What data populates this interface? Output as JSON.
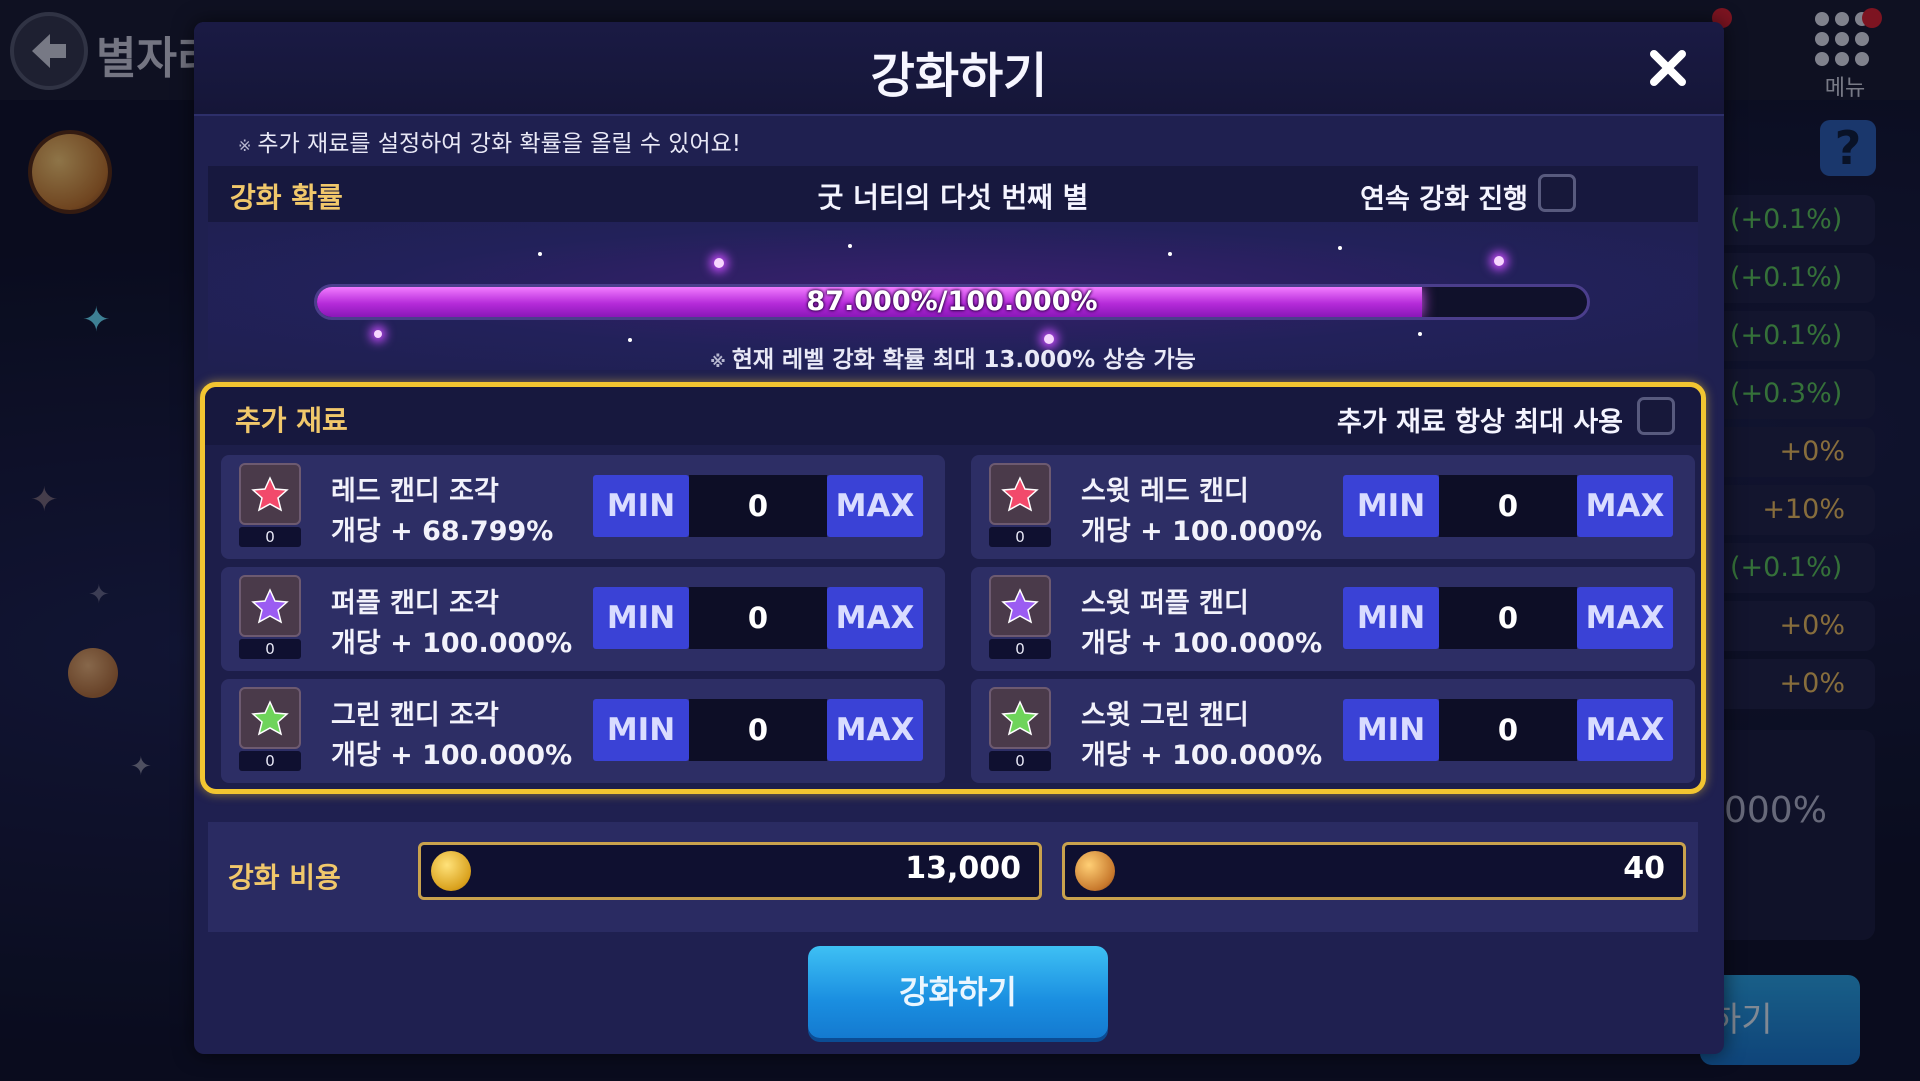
{
  "background": {
    "title": "별자리",
    "menu_label": "메뉴",
    "help_icon_text": "?",
    "side_rows": [
      "(+0.1%)",
      "(+0.1%)",
      "(+0.1%)",
      "(+0.3%)",
      "+0%",
      "+10%",
      "(+0.1%)",
      "+0%",
      "+0%"
    ],
    "side_big_text": "000%",
    "side_button_label": "하기"
  },
  "dialog": {
    "title": "강화하기",
    "notice": "추가 재료를 설정하여 강화 확률을 올릴 수 있어요!",
    "notice_mark": "※"
  },
  "probability": {
    "label": "강화 확률",
    "item_name": "굿 너티의 다섯 번째 별",
    "auto_label": "연속 강화 진행",
    "auto_checked": false,
    "bar_text": "87.000%/100.000%",
    "bar_fraction": 0.87,
    "note": "현재 레벨 강화 확률 최대 13.000% 상승 가능"
  },
  "materials": {
    "label": "추가 재료",
    "always_max_label": "추가 재료 항상 최대 사용",
    "always_max_checked": false,
    "min_label": "MIN",
    "max_label": "MAX",
    "items": [
      {
        "name": "레드 캔디 조각",
        "bonus": "개당 + 68.799%",
        "owned": "0",
        "qty": "0",
        "icon": "red-candy-piece-icon",
        "color": "#f24a6b"
      },
      {
        "name": "스윗 레드 캔디",
        "bonus": "개당 + 100.000%",
        "owned": "0",
        "qty": "0",
        "icon": "sweet-red-candy-icon",
        "color": "#f24a6b"
      },
      {
        "name": "퍼플 캔디 조각",
        "bonus": "개당 + 100.000%",
        "owned": "0",
        "qty": "0",
        "icon": "purple-candy-piece-icon",
        "color": "#9b5cf2"
      },
      {
        "name": "스윗 퍼플 캔디",
        "bonus": "개당 + 100.000%",
        "owned": "0",
        "qty": "0",
        "icon": "sweet-purple-candy-icon",
        "color": "#9b5cf2"
      },
      {
        "name": "그린 캔디 조각",
        "bonus": "개당 + 100.000%",
        "owned": "0",
        "qty": "0",
        "icon": "green-candy-piece-icon",
        "color": "#6fd45a"
      },
      {
        "name": "스윗 그린 캔디",
        "bonus": "개당 + 100.000%",
        "owned": "0",
        "qty": "0",
        "icon": "sweet-green-candy-icon",
        "color": "#6fd45a"
      }
    ]
  },
  "cost": {
    "label": "강화 비용",
    "gold": "13,000",
    "candy_jar": "40"
  },
  "enhance_button": "강화하기",
  "colors": {
    "accent_gold": "#f2c531",
    "button_blue": "#3a42d6",
    "progress_pink": "#e05bff"
  }
}
